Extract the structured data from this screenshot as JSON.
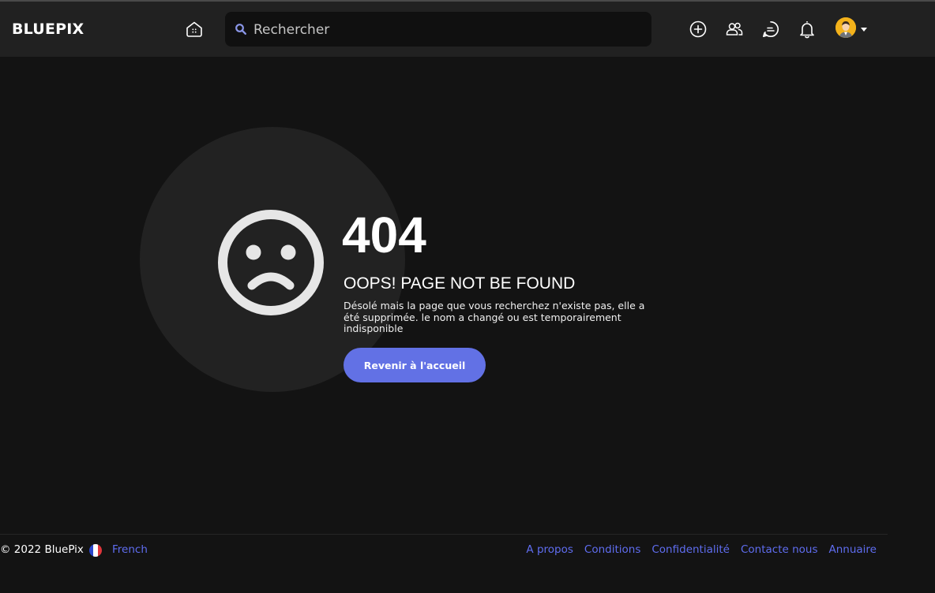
{
  "app": {
    "logo": "BLUEPIX"
  },
  "search": {
    "placeholder": "Rechercher",
    "value": ""
  },
  "nav_icons": [
    "home-icon",
    "add-circle-icon",
    "friends-icon",
    "messages-icon",
    "notifications-icon",
    "avatar",
    "chevron-down-icon"
  ],
  "error": {
    "code": "404",
    "title": "OOPS! PAGE NOT BE FOUND",
    "message": "Désolé mais la page que vous recherchez n'existe pas, elle a été supprimée. le nom a changé ou est temporairement indisponible",
    "button_label": "Revenir à l'accueil"
  },
  "footer": {
    "copyright": "© 2022 BluePix",
    "language": "French",
    "links": [
      "A propos",
      "Conditions",
      "Confidentialité",
      "Contacte nous",
      "Annuaire"
    ]
  },
  "colors": {
    "background": "#131313",
    "navbar": "#212121",
    "accent": "#6271e5",
    "link": "#5f6df0"
  }
}
